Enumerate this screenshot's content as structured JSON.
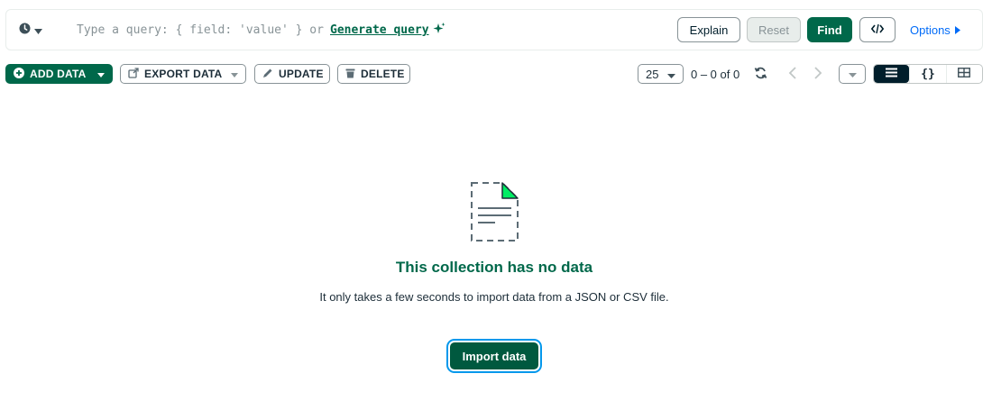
{
  "query_bar": {
    "history_icon": "clock-icon",
    "placeholder": "Type a query: { field: 'value' } or",
    "generate_query_link": "Generate query",
    "explain_label": "Explain",
    "reset_label": "Reset",
    "find_label": "Find",
    "code_icon": "code-icon",
    "options_label": "Options"
  },
  "toolbar": {
    "add_data_label": "ADD DATA",
    "export_data_label": "EXPORT DATA",
    "update_label": "UPDATE",
    "delete_label": "DELETE",
    "page_size": "25",
    "range_text": "0 – 0 of 0",
    "views": {
      "list": "list-view-icon",
      "json": "{}",
      "table": "table-view-icon",
      "active": "list"
    }
  },
  "empty_state": {
    "title": "This collection has no data",
    "description": "It only takes a few seconds to import data from a JSON or CSV file.",
    "import_button": "Import data"
  },
  "colors": {
    "primary_green": "#00684a",
    "import_green": "#00593f",
    "focus_blue": "#0498ec",
    "link_blue": "#016bf8",
    "accent_light_green": "#00ed64",
    "dark": "#001e2b"
  }
}
